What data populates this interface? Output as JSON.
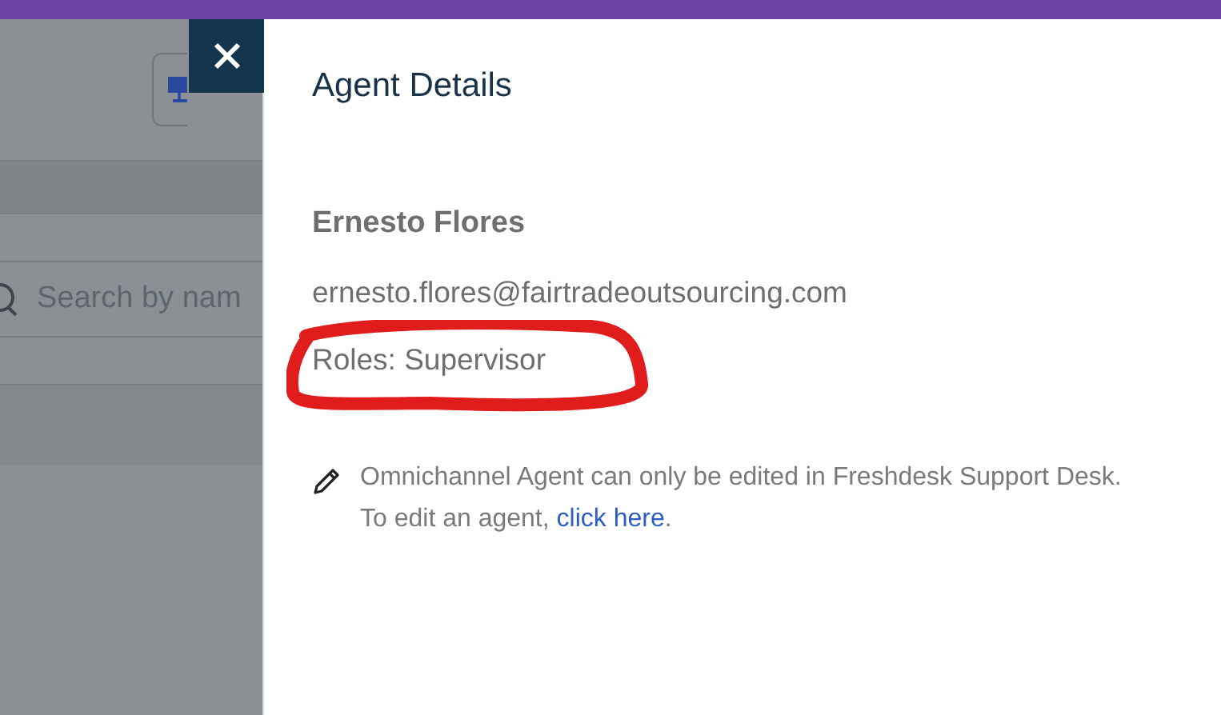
{
  "background": {
    "search": {
      "placeholder": "Search by nam"
    }
  },
  "panel": {
    "title": "Agent Details",
    "name": "Ernesto Flores",
    "email": "ernesto.flores@fairtradeoutsourcing.com",
    "roles": "Roles: Supervisor",
    "note": {
      "text": "Omnichannel Agent can only be edited in Freshdesk Support Desk. To edit an agent, ",
      "link": "click here",
      "end": "."
    }
  }
}
